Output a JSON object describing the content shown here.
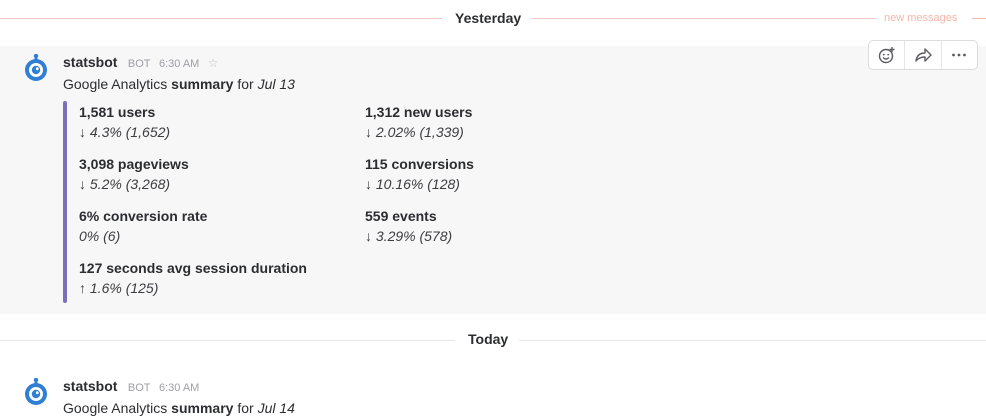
{
  "dividers": {
    "yesterday": "Yesterday",
    "new_messages": "new messages",
    "today": "Today"
  },
  "messages": [
    {
      "sender": "statsbot",
      "bot_tag": "BOT",
      "time": "6:30 AM",
      "text_prefix": "Google Analytics ",
      "text_bold": "summary",
      "text_mid": " for ",
      "text_date": "Jul 13",
      "fields": [
        {
          "title": "1,581 users",
          "value": "↓ 4.3% (1,652)"
        },
        {
          "title": "1,312 new users",
          "value": "↓ 2.02% (1,339)"
        },
        {
          "title": "3,098 pageviews",
          "value": "↓ 5.2% (3,268)"
        },
        {
          "title": "115 conversions",
          "value": "↓ 10.16% (128)"
        },
        {
          "title": "6% conversion rate",
          "value": "0% (6)"
        },
        {
          "title": "559 events",
          "value": "↓ 3.29% (578)"
        },
        {
          "title": "127 seconds avg session duration",
          "value": "↑ 1.6% (125)"
        }
      ]
    },
    {
      "sender": "statsbot",
      "bot_tag": "BOT",
      "time": "6:30 AM",
      "text_prefix": "Google Analytics ",
      "text_bold": "summary",
      "text_mid": " for ",
      "text_date": "Jul 14"
    }
  ],
  "icons": {
    "star": "☆",
    "add_reaction": "add-reaction-icon",
    "share": "share-icon",
    "more": "more-actions-icon"
  },
  "colors": {
    "accent_bar": "#7a6fb8",
    "new_messages": "#f2b6ab",
    "avatar": "#2f7fd4"
  }
}
